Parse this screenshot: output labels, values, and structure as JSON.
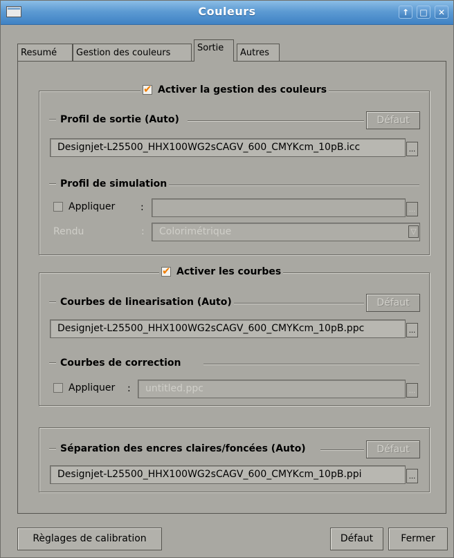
{
  "window": {
    "title": "Couleurs",
    "controls": [
      "↑",
      "□",
      "✕"
    ]
  },
  "tabs": [
    {
      "label": "Resumé"
    },
    {
      "label": "Gestion des couleurs"
    },
    {
      "label": "Sortie"
    },
    {
      "label": "Autres"
    }
  ],
  "active_tab": "Sortie",
  "color_management": {
    "enable_label": "Activer la gestion des couleurs",
    "enabled": true,
    "output_profile": {
      "heading": "Profil de sortie (Auto)",
      "default_button": "Défaut",
      "value": "Designjet-L25500_HHX100WG2sCAGV_600_CMYKcm_10pB.icc",
      "browse": "..."
    },
    "simulation_profile": {
      "heading": "Profil de simulation",
      "apply_label": "Appliquer",
      "apply_checked": false,
      "apply_colon": ":",
      "value": "",
      "browse": "...",
      "rendering_label": "Rendu",
      "rendering_colon": ":",
      "rendering_value": "Colorimétrique"
    }
  },
  "curves": {
    "enable_label": "Activer les courbes",
    "enabled": true,
    "linearization": {
      "heading": "Courbes de linearisation (Auto)",
      "default_button": "Défaut",
      "value": "Designjet-L25500_HHX100WG2sCAGV_600_CMYKcm_10pB.ppc",
      "browse": "..."
    },
    "correction": {
      "heading": "Courbes de correction",
      "apply_label": "Appliquer",
      "apply_checked": false,
      "apply_colon": ":",
      "value": "untitled.ppc",
      "browse": "..."
    }
  },
  "ink_separation": {
    "heading": "Séparation des encres claires/foncées (Auto)",
    "default_button": "Défaut",
    "value": "Designjet-L25500_HHX100WG2sCAGV_600_CMYKcm_10pB.ppi",
    "browse": "..."
  },
  "footer": {
    "calibration_button": "Règlages de calibration",
    "default_button": "Défaut",
    "close_button": "Fermer"
  }
}
